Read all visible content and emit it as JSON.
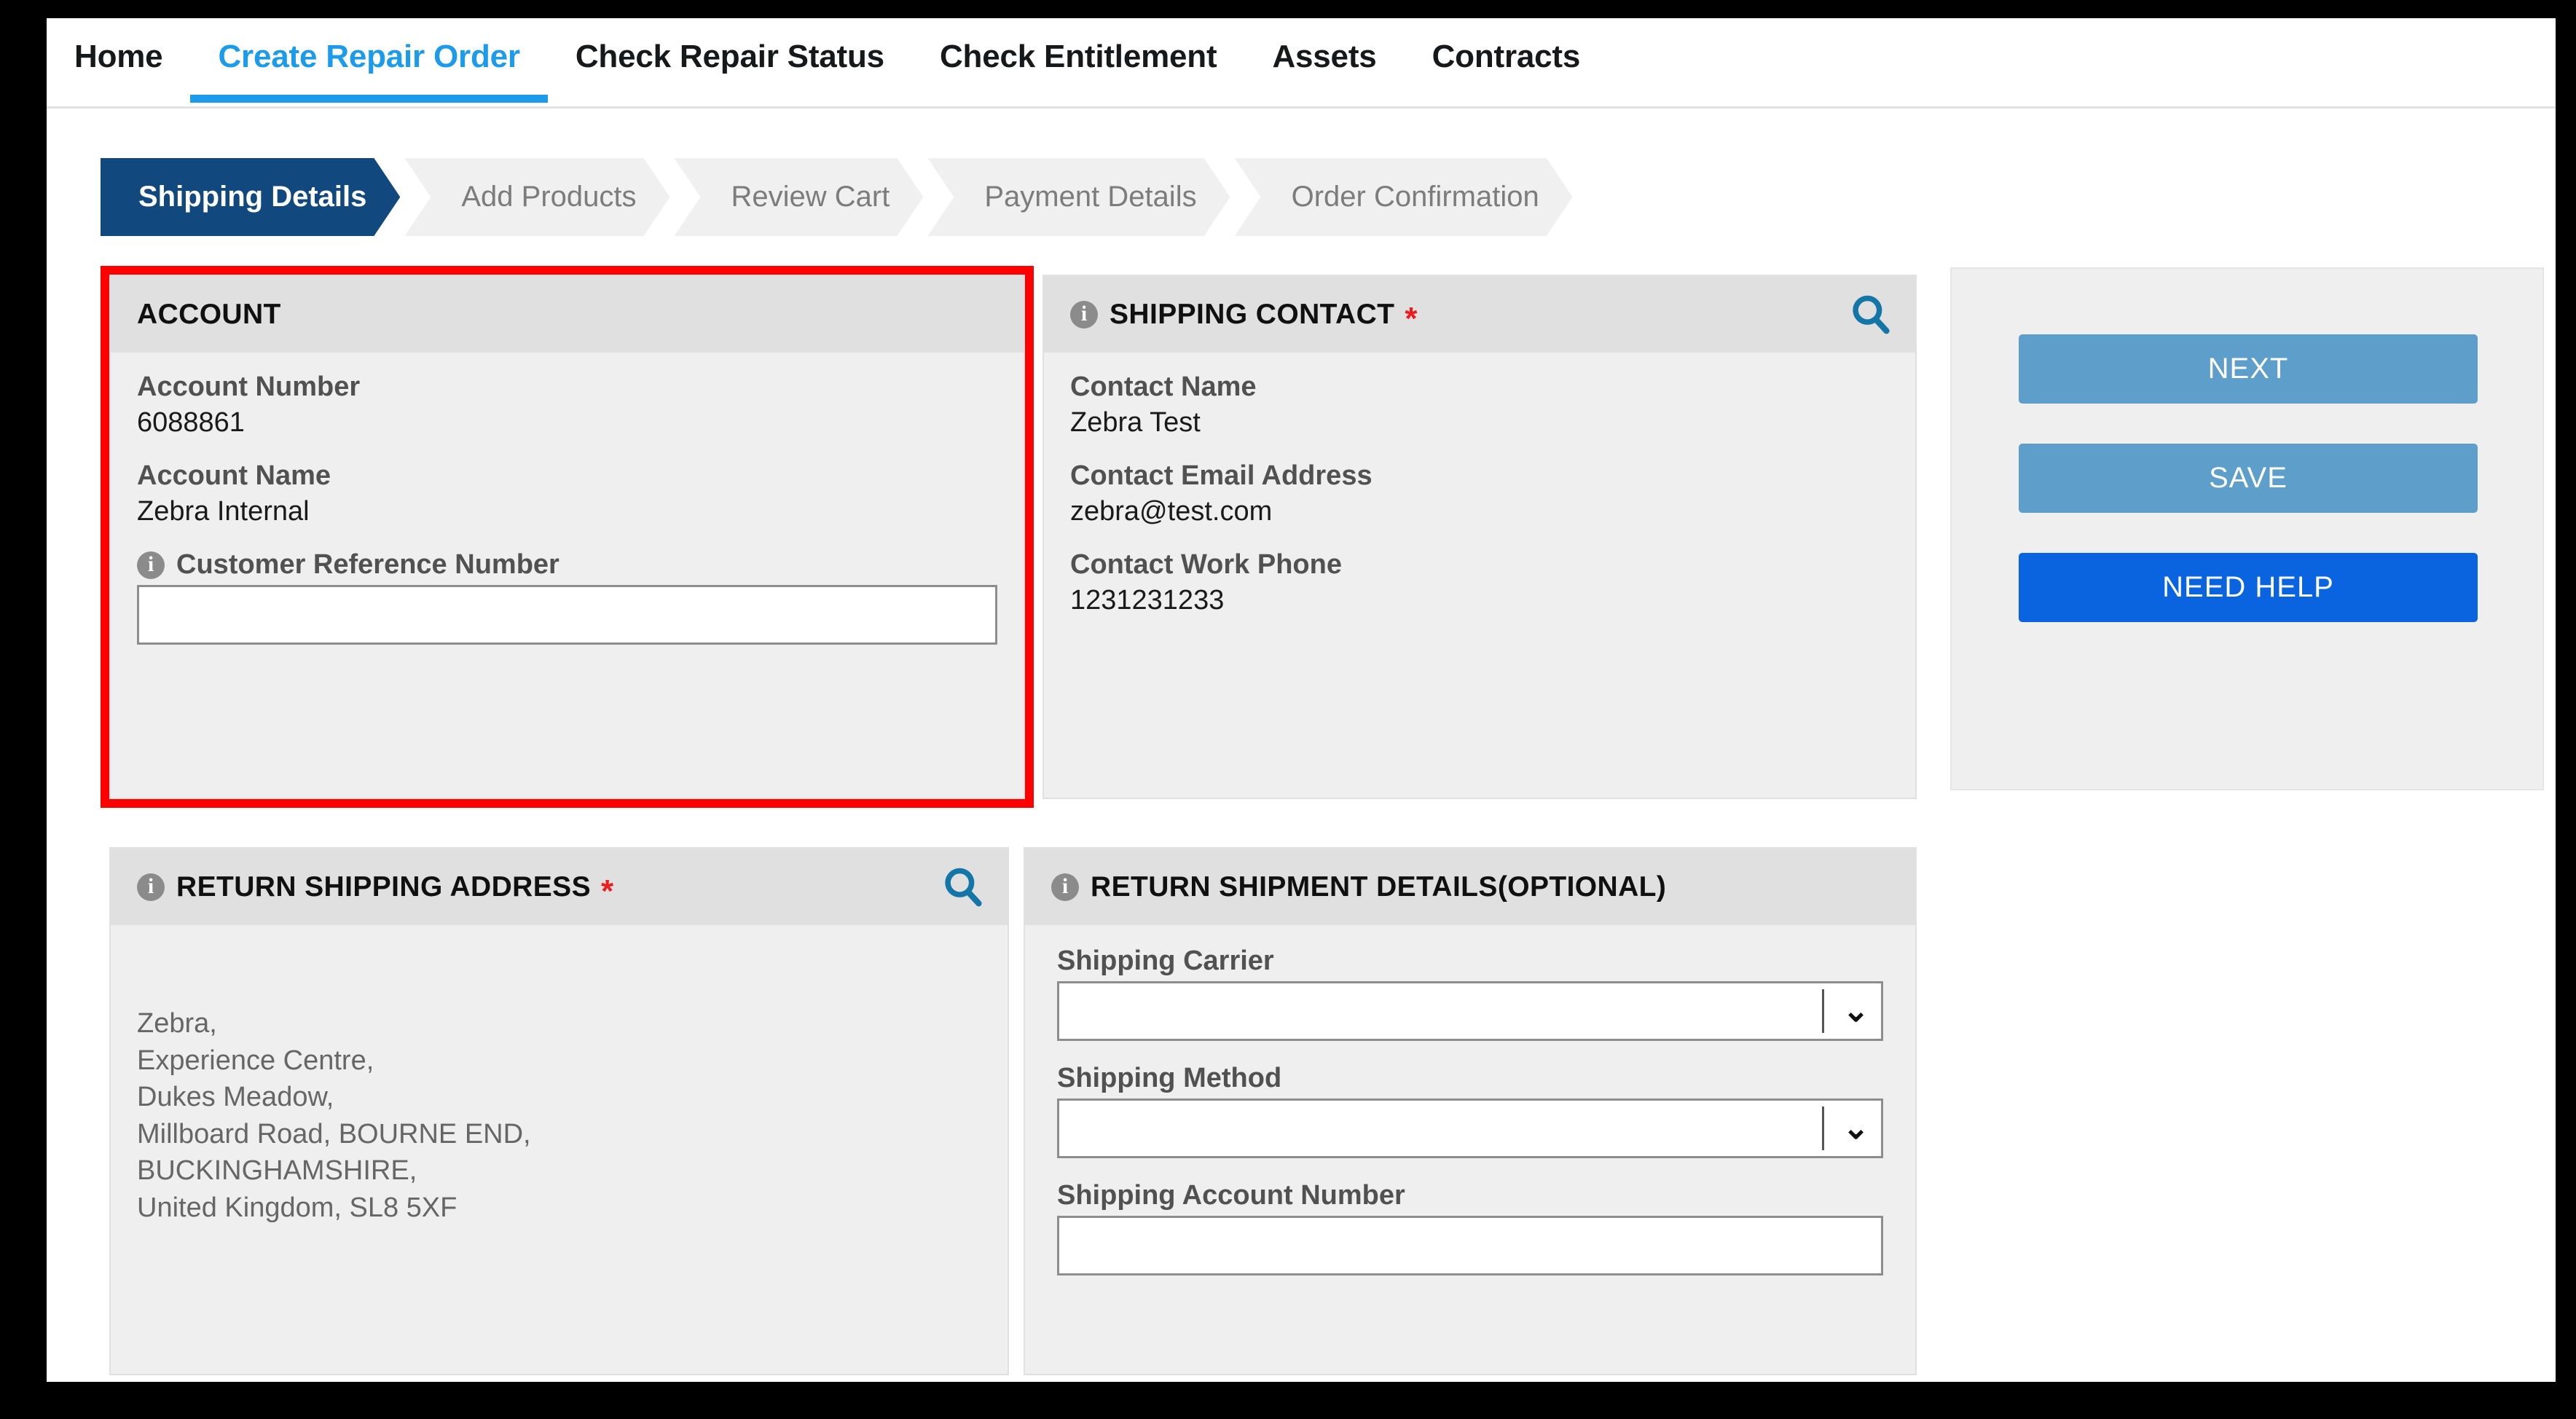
{
  "topnav": {
    "items": [
      {
        "label": "Home",
        "active": false
      },
      {
        "label": "Create Repair Order",
        "active": true
      },
      {
        "label": "Check Repair Status",
        "active": false
      },
      {
        "label": "Check Entitlement",
        "active": false
      },
      {
        "label": "Assets",
        "active": false
      },
      {
        "label": "Contracts",
        "active": false
      }
    ],
    "active_color": "#1b9bea"
  },
  "steps": [
    {
      "label": "Shipping Details",
      "current": true
    },
    {
      "label": "Add Products",
      "current": false
    },
    {
      "label": "Review Cart",
      "current": false
    },
    {
      "label": "Payment Details",
      "current": false
    },
    {
      "label": "Order Confirmation",
      "current": false
    }
  ],
  "step_colors": {
    "current_bg": "#11497e",
    "current_text": "#ffffff",
    "inactive_bg": "#f0f0f0",
    "inactive_text": "#7c7c7c"
  },
  "account_panel": {
    "title": "ACCOUNT",
    "fields": [
      {
        "label": "Account Number",
        "value": "6088861"
      },
      {
        "label": "Account Name",
        "value": "Zebra Internal"
      }
    ],
    "customer_reference": {
      "label": "Customer Reference Number",
      "value": "",
      "placeholder": "",
      "info_icon": "info-icon"
    }
  },
  "shipping_contact_panel": {
    "title": "SHIPPING CONTACT",
    "required_marker": "*",
    "info_icon": "info-icon",
    "search_icon": "search-icon",
    "fields": [
      {
        "label": "Contact Name",
        "value": "Zebra Test"
      },
      {
        "label": "Contact Email Address",
        "value": "zebra@test.com"
      },
      {
        "label": "Contact Work Phone",
        "value": "1231231233"
      }
    ]
  },
  "return_shipping_address_panel": {
    "title": "RETURN SHIPPING ADDRESS",
    "required_marker": "*",
    "info_icon": "info-icon",
    "search_icon": "search-icon",
    "address": "Zebra,\nExperience Centre,\nDukes Meadow,\nMillboard Road, BOURNE END,\nBUCKINGHAMSHIRE,\nUnited Kingdom, SL8 5XF"
  },
  "return_shipment_details_panel": {
    "title": "RETURN SHIPMENT DETAILS(OPTIONAL)",
    "info_icon": "info-icon",
    "shipping_carrier": {
      "label": "Shipping Carrier",
      "value": "",
      "chevron_icon": "chevron-down-icon"
    },
    "shipping_method": {
      "label": "Shipping Method",
      "value": "",
      "chevron_icon": "chevron-down-icon"
    },
    "shipping_account_number": {
      "label": "Shipping Account Number",
      "value": "",
      "placeholder": ""
    }
  },
  "actions": {
    "next_label": "NEXT",
    "save_label": "SAVE",
    "help_label": "NEED HELP",
    "next_color": "#5d9ecb",
    "save_color": "#5d9ecb",
    "help_color": "#0a64e0"
  },
  "annotation": {
    "shape": "rectangle",
    "color": "#fe0000",
    "target": "account-panel"
  }
}
